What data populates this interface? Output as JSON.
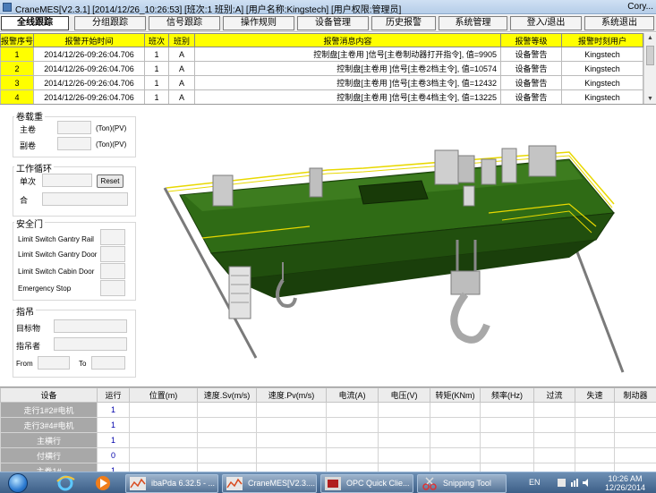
{
  "window": {
    "title": "CraneMES[V2.3.1] [2014/12/26_10:26:53] [班次:1 班别:A] [用户名称:Kingstech] [用户权限:管理员]",
    "corner_text": "Cory..."
  },
  "menu": [
    {
      "label": "全线跟踪",
      "active": true
    },
    {
      "label": "分组跟踪"
    },
    {
      "label": "信号跟踪"
    },
    {
      "label": "操作规则"
    },
    {
      "label": "设备管理"
    },
    {
      "label": "历史报警"
    },
    {
      "label": "系统管理"
    },
    {
      "label": "登入/退出"
    },
    {
      "label": "系统退出"
    }
  ],
  "alarm_table": {
    "headers": [
      "报警序号",
      "报警开始时间",
      "班次",
      "班别",
      "报警消息内容",
      "报警等级",
      "报警时刻用户"
    ],
    "rows": [
      [
        "1",
        "2014/12/26-09:26:04.706",
        "1",
        "A",
        "控制盘[主卷用 ]信号[主卷制动器打开指令], 值=9905",
        "设备警告",
        "Kingstech"
      ],
      [
        "2",
        "2014/12/26-09:26:04.706",
        "1",
        "A",
        "控制盘[主卷用 ]信号[主卷2档主令], 值=10574",
        "设备警告",
        "Kingstech"
      ],
      [
        "3",
        "2014/12/26-09:26:04.706",
        "1",
        "A",
        "控制盘[主卷用 ]信号[主卷3档主令], 值=12432",
        "设备警告",
        "Kingstech"
      ],
      [
        "4",
        "2014/12/26-09:26:04.706",
        "1",
        "A",
        "控制盘[主卷用 ]信号[主卷4档主令], 值=13225",
        "设备警告",
        "Kingstech"
      ]
    ]
  },
  "left_panel": {
    "load": {
      "title": "卷载重",
      "main_label": "主卷",
      "aux_label": "副卷",
      "main_unit": "(Ton)(PV)",
      "aux_unit": "(Ton)(PV)"
    },
    "cycle": {
      "title": "工作循环",
      "single_label": "单次",
      "total_label": "合",
      "reset_label": "Reset"
    },
    "safety": {
      "title": "安全门",
      "items": [
        "Limit Switch Gantry Rail",
        "Limit Switch Gantry Door",
        "Limit Switch Cabin Door",
        "Emergency Stop"
      ]
    },
    "hoist": {
      "title": "指吊",
      "target_label": "目标物",
      "hoister_label": "指吊者",
      "from_label": "From",
      "to_label": "To"
    }
  },
  "equipment_table": {
    "headers": [
      "设备",
      "运行",
      "位置(m)",
      "速度.Sv(m/s)",
      "速度.Pv(m/s)",
      "电流(A)",
      "电压(V)",
      "转矩(KNm)",
      "频率(Hz)",
      "过流",
      "失速",
      "制动器"
    ],
    "rows": [
      [
        "走行1#2#电机",
        "1"
      ],
      [
        "走行3#4#电机",
        "1"
      ],
      [
        "主横行",
        "1"
      ],
      [
        "付横行",
        "0"
      ],
      [
        "主卷1#",
        "1"
      ]
    ]
  },
  "taskbar": {
    "tasks": [
      "ibaPda 6.32.5 - ...",
      "CraneMES[V2.3....",
      "OPC Quick Clie...",
      "Snipping Tool"
    ],
    "lang": "EN",
    "time": "10:26 AM",
    "date": "12/26/2014"
  }
}
